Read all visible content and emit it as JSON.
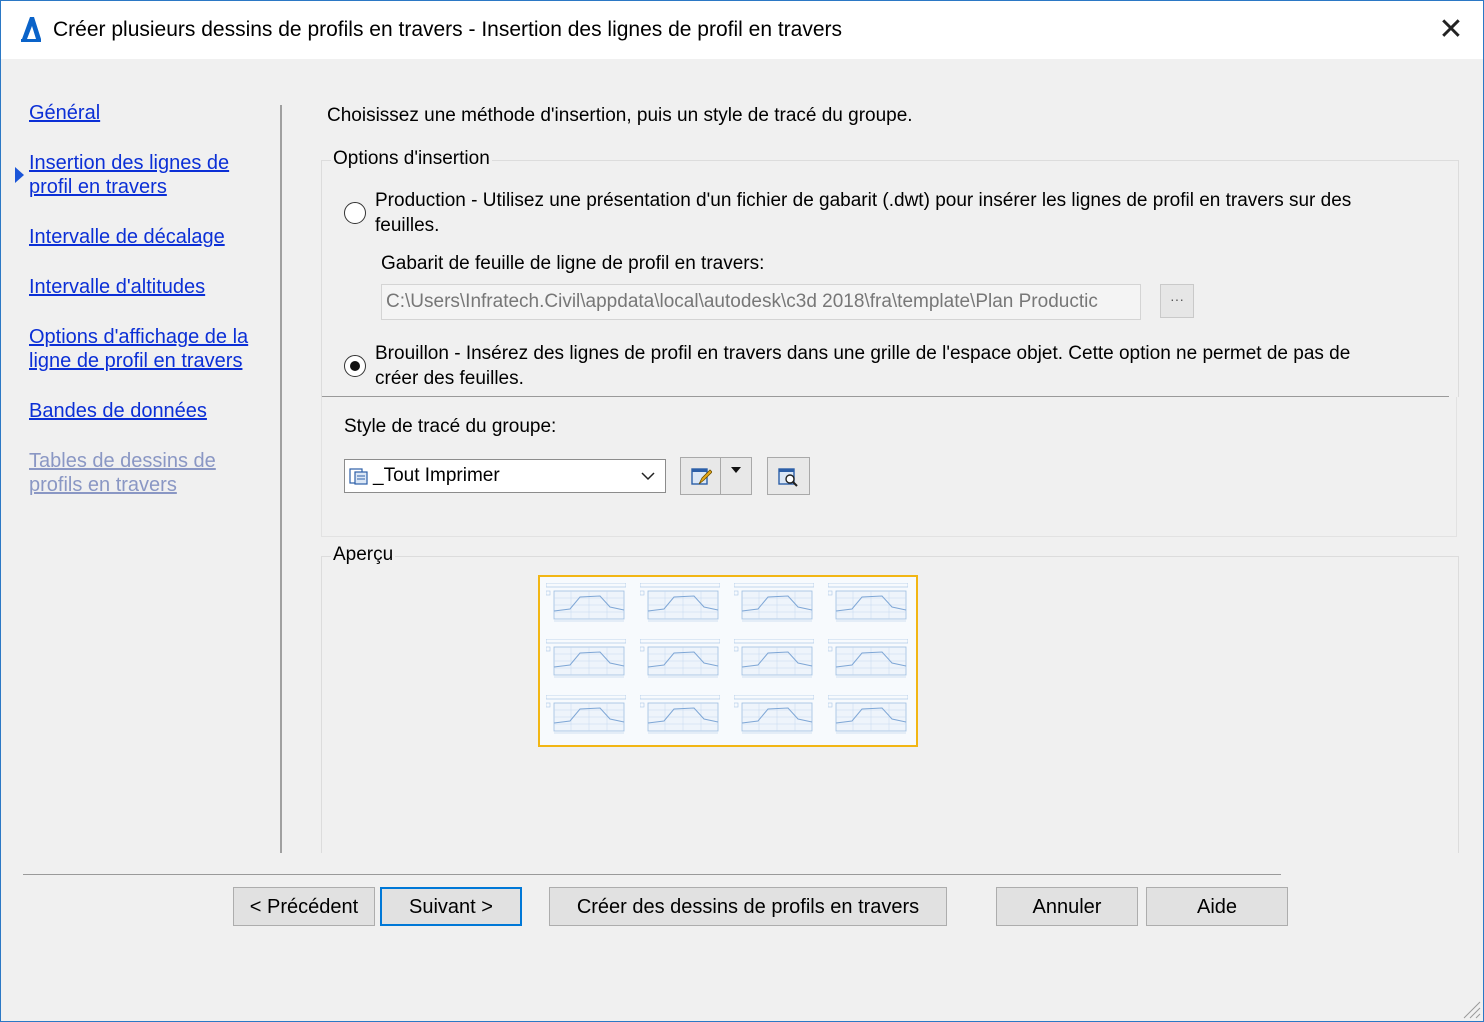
{
  "window": {
    "title": "Créer plusieurs dessins de profils en travers - Insertion des lignes de profil en travers",
    "close_glyph": "✕",
    "app_icon": "autocad-civil3d-icon",
    "accent": "#0078d7"
  },
  "nav": {
    "items": [
      {
        "label": "Général",
        "state": "link"
      },
      {
        "label": "Insertion des lignes de profil en travers",
        "state": "current"
      },
      {
        "label": "Intervalle de décalage",
        "state": "link"
      },
      {
        "label": "Intervalle d'altitudes",
        "state": "link"
      },
      {
        "label": "Options d'affichage de la ligne de profil en travers",
        "state": "link"
      },
      {
        "label": "Bandes de données",
        "state": "link"
      },
      {
        "label": "Tables de dessins de profils en travers",
        "state": "disabled"
      }
    ],
    "item_lines": [
      [
        "Général"
      ],
      [
        "Insertion des lignes de ",
        "profil en travers"
      ],
      [
        "Intervalle de décalage"
      ],
      [
        "Intervalle d'altitudes"
      ],
      [
        "Options d'affichage de la ",
        "ligne de profil en travers"
      ],
      [
        "Bandes de données"
      ],
      [
        "Tables de dessins de ",
        "profils en travers"
      ]
    ]
  },
  "main": {
    "intro": "Choisissez une méthode d'insertion, puis un style de tracé du groupe.",
    "insertion_group": {
      "legend": "Options d'insertion",
      "production": {
        "text_line1": "Production - Utilisez une présentation d'un fichier de gabarit (.dwt) pour insérer les lignes de profil en travers sur des",
        "text_line2": "feuilles.",
        "checked": false
      },
      "template_label": "Gabarit de feuille de ligne de profil en travers:",
      "template_value": "C:\\Users\\Infratech.Civil\\appdata\\local\\autodesk\\c3d 2018\\fra\\template\\Plan Productic",
      "browse_label": "···",
      "draft": {
        "text_line1": "Brouillon - Insérez des lignes de profil en travers dans une grille de l'espace objet. Cette option ne permet de pas de",
        "text_line2": "créer des feuilles.",
        "checked": true
      }
    },
    "style": {
      "label": "Style de tracé du groupe:",
      "selected": "_Tout Imprimer",
      "icons": [
        "style-list-icon",
        "edit-style-icon",
        "dropdown-arrow-icon",
        "preview-style-icon"
      ]
    },
    "preview": {
      "legend": "Aperçu",
      "rows": 3,
      "cols": 4,
      "border_color": "#f2b614"
    }
  },
  "buttons": {
    "previous": "< Précédent",
    "next": "Suivant >",
    "create": "Créer des dessins de profils en travers",
    "cancel": "Annuler",
    "help": "Aide"
  }
}
